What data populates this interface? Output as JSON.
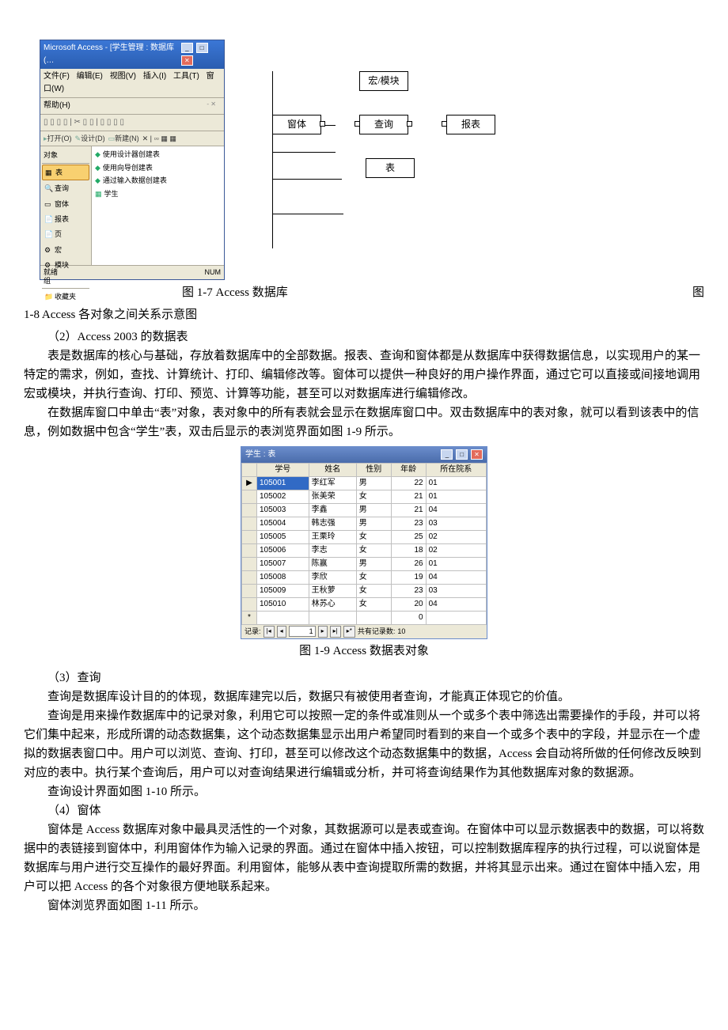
{
  "fig17": {
    "title": "Microsoft Access - [学生管理 : 数据库 (…",
    "menus": [
      "文件(F)",
      "编辑(E)",
      "视图(V)",
      "插入(I)",
      "工具(T)",
      "窗口(W)"
    ],
    "help": "帮助(H)",
    "subwin_close_hint": "- ✕",
    "toolbar2": {
      "open": "打开(O)",
      "design": "设计(D)",
      "new": "新建(N)",
      "icons": "✕ | ▫▫  ▦ ▦"
    },
    "side_header": "对象",
    "side_items": [
      {
        "icon": "▦",
        "label": "表",
        "sel": true
      },
      {
        "icon": "🔍",
        "label": "查询"
      },
      {
        "icon": "▭",
        "label": "窗体"
      },
      {
        "icon": "📄",
        "label": "报表"
      },
      {
        "icon": "📄",
        "label": "页"
      },
      {
        "icon": "⚙",
        "label": "宏"
      },
      {
        "icon": "⚙",
        "label": "模块"
      }
    ],
    "side_group": "组",
    "side_fav": "收藏夹",
    "main_items": [
      {
        "icon": "◆",
        "label": "使用设计器创建表"
      },
      {
        "icon": "◆",
        "label": "使用向导创建表"
      },
      {
        "icon": "◆",
        "label": "通过输入数据创建表"
      },
      {
        "icon": "▦",
        "label": "学生"
      }
    ],
    "status_left": "就绪",
    "status_right": "NUM"
  },
  "fig18": {
    "macro": "宏/模块",
    "form": "窗体",
    "query": "查询",
    "report": "报表",
    "table": "表"
  },
  "caption_17": "图 1-7    Access 数据库",
  "caption_18_prefix": "图",
  "caption_18_line": "1-8    Access 各对象之间关系示意图",
  "sec2_heading": "（2）Access 2003 的数据表",
  "sec2_p1": "表是数据库的核心与基础，存放着数据库中的全部数据。报表、查询和窗体都是从数据库中获得数据信息，以实现用户的某一特定的需求，例如，查找、计算统计、打印、编辑修改等。窗体可以提供一种良好的用户操作界面，通过它可以直接或间接地调用宏或模块，并执行查询、打印、预览、计算等功能，甚至可以对数据库进行编辑修改。",
  "sec2_p2": "在数据库窗口中单击“表”对象，表对象中的所有表就会显示在数据库窗口中。双击数据库中的表对象，就可以看到该表中的信息，例如数据中包含“学生”表，双击后显示的表浏览界面如图 1-9 所示。",
  "chart_data": {
    "type": "table",
    "title": "学生 : 表",
    "columns": [
      "学号",
      "姓名",
      "性别",
      "年龄",
      "所在院系"
    ],
    "rows": [
      [
        "105001",
        "李红军",
        "男",
        "22",
        "01"
      ],
      [
        "105002",
        "张美荣",
        "女",
        "21",
        "01"
      ],
      [
        "105003",
        "李鑫",
        "男",
        "21",
        "04"
      ],
      [
        "105004",
        "韩志强",
        "男",
        "23",
        "03"
      ],
      [
        "105005",
        "王栗玲",
        "女",
        "25",
        "02"
      ],
      [
        "105006",
        "李志",
        "女",
        "18",
        "02"
      ],
      [
        "105007",
        "陈赢",
        "男",
        "26",
        "01"
      ],
      [
        "105008",
        "李欣",
        "女",
        "19",
        "04"
      ],
      [
        "105009",
        "王秋萝",
        "女",
        "23",
        "03"
      ],
      [
        "105010",
        "林苏心",
        "女",
        "20",
        "04"
      ],
      [
        "",
        "",
        "",
        "0",
        ""
      ]
    ],
    "nav": {
      "label": "记录:",
      "current": "1",
      "total_label": "共有记录数:",
      "total": "10"
    },
    "annotations": {
      "selected_row_index": 0,
      "selected_col_index": 0
    }
  },
  "caption_19": "图 1-9    Access 数据表对象",
  "sec3_heading": "（3）查询",
  "sec3_p1": "查询是数据库设计目的的体现，数据库建完以后，数据只有被使用者查询，才能真正体现它的价值。",
  "sec3_p2": "查询是用来操作数据库中的记录对象，利用它可以按照一定的条件或准则从一个或多个表中筛选出需要操作的手段，并可以将它们集中起来，形成所谓的动态数据集，这个动态数据集显示出用户希望同时看到的来自一个或多个表中的字段，并显示在一个虚拟的数据表窗口中。用户可以浏览、查询、打印，甚至可以修改这个动态数据集中的数据，Access 会自动将所做的任何修改反映到对应的表中。执行某个查询后，用户可以对查询结果进行编辑或分析，并可将查询结果作为其他数据库对象的数据源。",
  "sec3_p3": "查询设计界面如图 1-10 所示。",
  "sec4_heading": "（4）窗体",
  "sec4_p1": "窗体是 Access 数据库对象中最具灵活性的一个对象，其数据源可以是表或查询。在窗体中可以显示数据表中的数据，可以将数据中的表链接到窗体中，利用窗体作为输入记录的界面。通过在窗体中插入按钮，可以控制数据库程序的执行过程，可以说窗体是数据库与用户进行交互操作的最好界面。利用窗体，能够从表中查询提取所需的数据，并将其显示出来。通过在窗体中插入宏，用户可以把 Access 的各个对象很方便地联系起来。",
  "sec4_p2": "窗体浏览界面如图 1-11 所示。"
}
